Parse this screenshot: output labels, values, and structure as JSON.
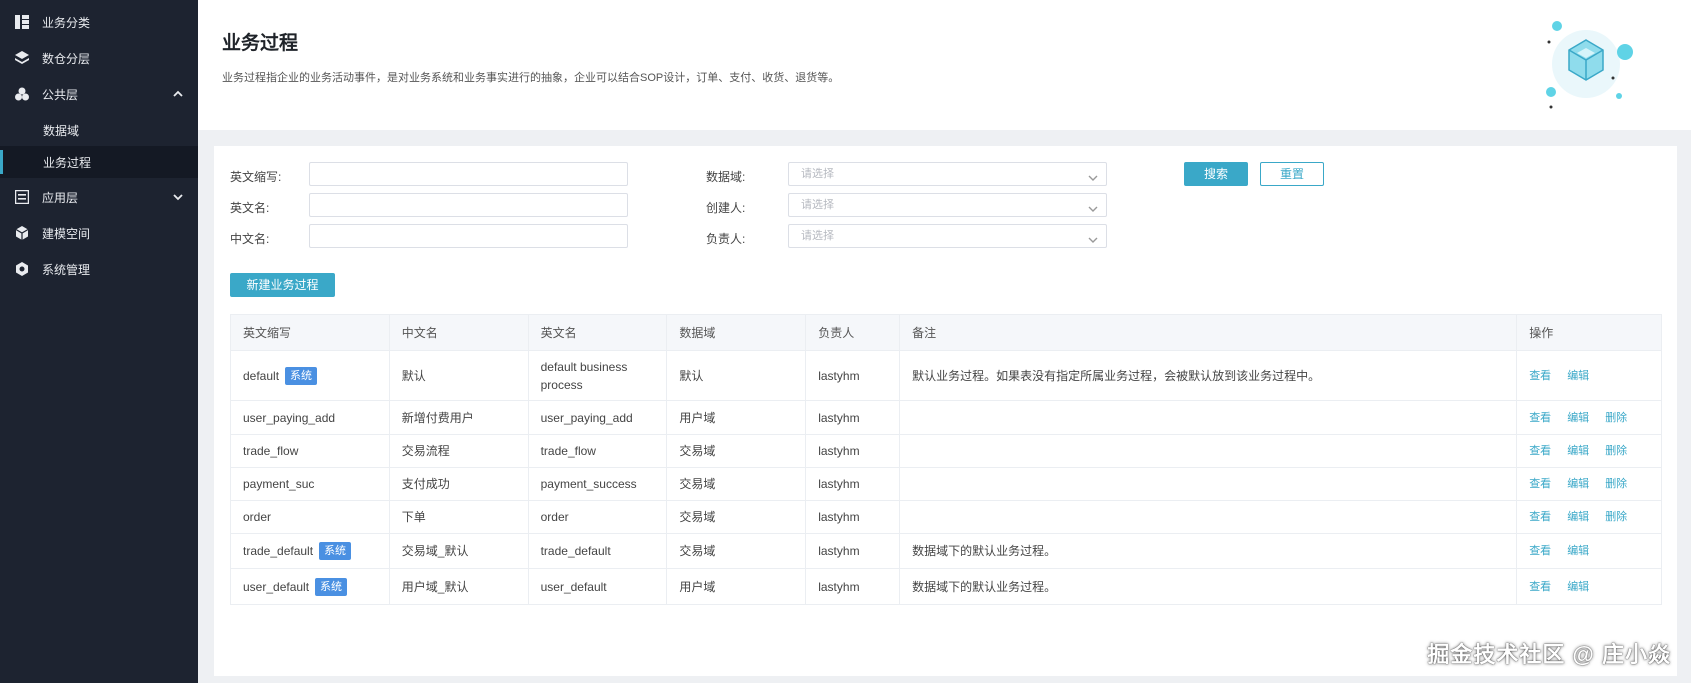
{
  "sidebar": {
    "items": [
      {
        "label": "业务分类",
        "icon": "grid-icon"
      },
      {
        "label": "数仓分层",
        "icon": "layers-icon"
      },
      {
        "label": "公共层",
        "icon": "cluster-icon",
        "expanded": true
      },
      {
        "label": "数据域",
        "sub": true
      },
      {
        "label": "业务过程",
        "sub": true,
        "active": true
      },
      {
        "label": "应用层",
        "icon": "list-icon",
        "expanded": false
      },
      {
        "label": "建模空间",
        "icon": "cube-icon"
      },
      {
        "label": "系统管理",
        "icon": "hexagon-gear-icon"
      }
    ]
  },
  "header": {
    "title": "业务过程",
    "description": "业务过程指企业的业务活动事件，是对业务系统和业务事实进行的抽象，企业可以结合SOP设计，订单、支付、收货、退货等。"
  },
  "filters": {
    "abbr_label": "英文缩写:",
    "en_label": "英文名:",
    "cn_label": "中文名:",
    "domain_label": "数据域:",
    "creator_label": "创建人:",
    "owner_label": "负责人:",
    "select_placeholder": "请选择",
    "search_button": "搜索",
    "reset_button": "重置"
  },
  "new_button": "新建业务过程",
  "table": {
    "headers": [
      "英文缩写",
      "中文名",
      "英文名",
      "数据域",
      "负责人",
      "备注",
      "操作"
    ],
    "system_badge": "系统",
    "actions": {
      "view": "查看",
      "edit": "编辑",
      "delete": "删除"
    },
    "rows": [
      {
        "abbr": "default",
        "system": true,
        "cn": "默认",
        "en": "default business process",
        "domain": "默认",
        "owner": "lastyhm",
        "note": "默认业务过程。如果表没有指定所属业务过程，会被默认放到该业务过程中。",
        "deletable": false
      },
      {
        "abbr": "user_paying_add",
        "system": false,
        "cn": "新增付费用户",
        "en": "user_paying_add",
        "domain": "用户域",
        "owner": "lastyhm",
        "note": "",
        "deletable": true
      },
      {
        "abbr": "trade_flow",
        "system": false,
        "cn": "交易流程",
        "en": "trade_flow",
        "domain": "交易域",
        "owner": "lastyhm",
        "note": "",
        "deletable": true
      },
      {
        "abbr": "payment_suc",
        "system": false,
        "cn": "支付成功",
        "en": "payment_success",
        "domain": "交易域",
        "owner": "lastyhm",
        "note": "",
        "deletable": true
      },
      {
        "abbr": "order",
        "system": false,
        "cn": "下单",
        "en": "order",
        "domain": "交易域",
        "owner": "lastyhm",
        "note": "",
        "deletable": true
      },
      {
        "abbr": "trade_default",
        "system": true,
        "cn": "交易域_默认",
        "en": "trade_default",
        "domain": "交易域",
        "owner": "lastyhm",
        "note": "数据域下的默认业务过程。",
        "deletable": false
      },
      {
        "abbr": "user_default",
        "system": true,
        "cn": "用户域_默认",
        "en": "user_default",
        "domain": "用户域",
        "owner": "lastyhm",
        "note": "数据域下的默认业务过程。",
        "deletable": false
      }
    ]
  },
  "watermark": "掘金技术社区 @ 庄小焱",
  "colors": {
    "sidebar": "#1d2330",
    "accent": "#3aa8c8",
    "badge": "#4a90e2"
  }
}
